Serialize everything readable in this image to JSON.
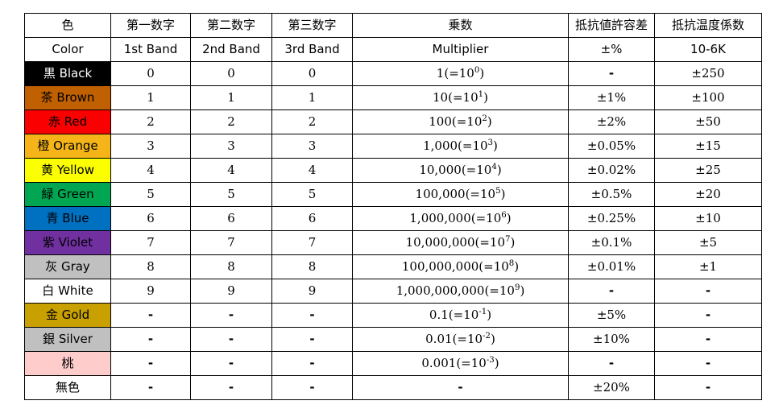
{
  "table": {
    "headers_jp": [
      "色",
      "第一数字",
      "第二数字",
      "第三数字",
      "乗数",
      "抵抗値許容差",
      "抵抗温度係数"
    ],
    "headers_en": [
      "Color",
      "1st Band",
      "2nd Band",
      "3rd Band",
      "Multiplier",
      "±%",
      "10-6K"
    ],
    "rows": [
      {
        "color_label": "黒 Black",
        "bg": "#000000",
        "fg": "#ffffff",
        "band1": "0",
        "band2": "0",
        "band3": "0",
        "multiplier_base": "1(=10",
        "multiplier_exp": "0",
        "multiplier_close": ")",
        "tolerance": "-",
        "tcr": "±250",
        "comment_marker": true
      },
      {
        "color_label": "茶 Brown",
        "bg": "#c06000",
        "fg": "#000000",
        "band1": "1",
        "band2": "1",
        "band3": "1",
        "multiplier_base": "10(=10",
        "multiplier_exp": "1",
        "multiplier_close": ")",
        "tolerance": "±1%",
        "tcr": "±100",
        "comment_marker": true
      },
      {
        "color_label": "赤 Red",
        "bg": "#fa0000",
        "fg": "#000000",
        "band1": "2",
        "band2": "2",
        "band3": "2",
        "multiplier_base": "100(=10",
        "multiplier_exp": "2",
        "multiplier_close": ")",
        "tolerance": "±2%",
        "tcr": "±50",
        "comment_marker": true
      },
      {
        "color_label": "橙 Orange",
        "bg": "#f5b519",
        "fg": "#000000",
        "band1": "3",
        "band2": "3",
        "band3": "3",
        "multiplier_base": "1,000(=10",
        "multiplier_exp": "3",
        "multiplier_close": ")",
        "tolerance": "±0.05%",
        "tcr": "±15",
        "comment_marker": true
      },
      {
        "color_label": "黄 Yellow",
        "bg": "#fbff00",
        "fg": "#000000",
        "band1": "4",
        "band2": "4",
        "band3": "4",
        "multiplier_base": "10,000(=10",
        "multiplier_exp": "4",
        "multiplier_close": ")",
        "tolerance": "±0.02%",
        "tcr": "±25",
        "comment_marker": true
      },
      {
        "color_label": "緑 Green",
        "bg": "#00a651",
        "fg": "#000000",
        "band1": "5",
        "band2": "5",
        "band3": "5",
        "multiplier_base": "100,000(=10",
        "multiplier_exp": "5",
        "multiplier_close": ")",
        "tolerance": "±0.5%",
        "tcr": "±20",
        "comment_marker": true
      },
      {
        "color_label": "青 Blue",
        "bg": "#0070c0",
        "fg": "#000000",
        "band1": "6",
        "band2": "6",
        "band3": "6",
        "multiplier_base": "1,000,000(=10",
        "multiplier_exp": "6",
        "multiplier_close": ")",
        "tolerance": "±0.25%",
        "tcr": "±10",
        "comment_marker": true
      },
      {
        "color_label": "紫 Violet",
        "bg": "#7030a0",
        "fg": "#000000",
        "band1": "7",
        "band2": "7",
        "band3": "7",
        "multiplier_base": "10,000,000(=10",
        "multiplier_exp": "7",
        "multiplier_close": ")",
        "tolerance": "±0.1%",
        "tcr": "±5",
        "comment_marker": true
      },
      {
        "color_label": "灰 Gray",
        "bg": "#c0c0c0",
        "fg": "#000000",
        "band1": "8",
        "band2": "8",
        "band3": "8",
        "multiplier_base": "100,000,000(=10",
        "multiplier_exp": "8",
        "multiplier_close": ")",
        "tolerance": "±0.01%",
        "tcr": "±1",
        "comment_marker": true
      },
      {
        "color_label": "白 White",
        "bg": "#ffffff",
        "fg": "#000000",
        "band1": "9",
        "band2": "9",
        "band3": "9",
        "multiplier_base": "1,000,000,000(=10",
        "multiplier_exp": "9",
        "multiplier_close": ")",
        "tolerance": "-",
        "tcr": "-",
        "comment_marker": true
      },
      {
        "color_label": "金 Gold",
        "bg": "#c8a000",
        "fg": "#000000",
        "band1": "-",
        "band2": "-",
        "band3": "-",
        "multiplier_base": "0.1(=10",
        "multiplier_exp": "-1",
        "multiplier_close": ")",
        "tolerance": "±5%",
        "tcr": "-",
        "comment_marker": false
      },
      {
        "color_label": "銀 Silver",
        "bg": "#c0c0c0",
        "fg": "#000000",
        "band1": "-",
        "band2": "-",
        "band3": "-",
        "multiplier_base": "0.01(=10",
        "multiplier_exp": "-2",
        "multiplier_close": ")",
        "tolerance": "±10%",
        "tcr": "-",
        "comment_marker": false
      },
      {
        "color_label": "桃",
        "bg": "#ffcccc",
        "fg": "#000000",
        "band1": "-",
        "band2": "-",
        "band3": "-",
        "multiplier_base": "0.001(=10",
        "multiplier_exp": "-3",
        "multiplier_close": ")",
        "tolerance": "-",
        "tcr": "-",
        "comment_marker": false
      },
      {
        "color_label": "無色",
        "bg": "#ffffff",
        "fg": "#000000",
        "band1": "-",
        "band2": "-",
        "band3": "-",
        "multiplier_base": "-",
        "multiplier_exp": "",
        "multiplier_close": "",
        "tolerance": "±20%",
        "tcr": "-",
        "comment_marker": false
      }
    ]
  }
}
